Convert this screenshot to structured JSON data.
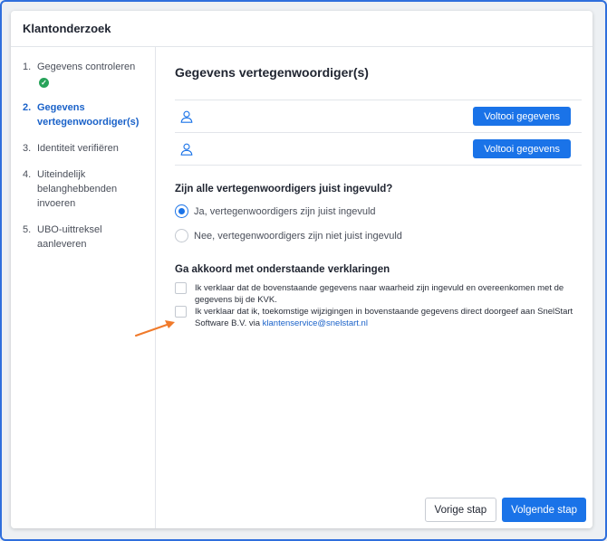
{
  "header": {
    "title": "Klantonderzoek"
  },
  "sidebar": {
    "steps": [
      {
        "num": "1.",
        "label": "Gegevens controleren"
      },
      {
        "num": "2.",
        "label": "Gegevens vertegenwoordiger(s)"
      },
      {
        "num": "3.",
        "label": "Identiteit verifiëren"
      },
      {
        "num": "4.",
        "label": "Uiteindelijk belanghebbenden invoeren"
      },
      {
        "num": "5.",
        "label": "UBO-uittreksel aanleveren"
      }
    ]
  },
  "main": {
    "title": "Gegevens vertegenwoordiger(s)",
    "representatives": [
      {
        "button": "Voltooi gegevens"
      },
      {
        "button": "Voltooi gegevens"
      }
    ],
    "question": "Zijn alle vertegenwoordigers juist ingevuld?",
    "options": [
      {
        "label": "Ja, vertegenwoordigers zijn juist ingevuld",
        "checked": true
      },
      {
        "label": "Nee, vertegenwoordigers zijn niet juist ingevuld",
        "checked": false
      }
    ],
    "agree_title": "Ga akkoord met onderstaande verklaringen",
    "declarations": [
      {
        "text": "Ik verklaar dat de bovenstaande gegevens naar waarheid zijn ingevuld en overeenkomen met de gegevens bij de KVK."
      },
      {
        "text": "Ik verklaar dat ik, toekomstige wijzigingen in bovenstaande gegevens direct doorgeef aan SnelStart Software B.V. via ",
        "link": "klantenservice@snelstart.nl"
      }
    ]
  },
  "footer": {
    "prev": "Vorige stap",
    "next": "Volgende stap"
  },
  "colors": {
    "accent": "#1a73e8",
    "success": "#27a35a",
    "arrow": "#f07a2b"
  }
}
